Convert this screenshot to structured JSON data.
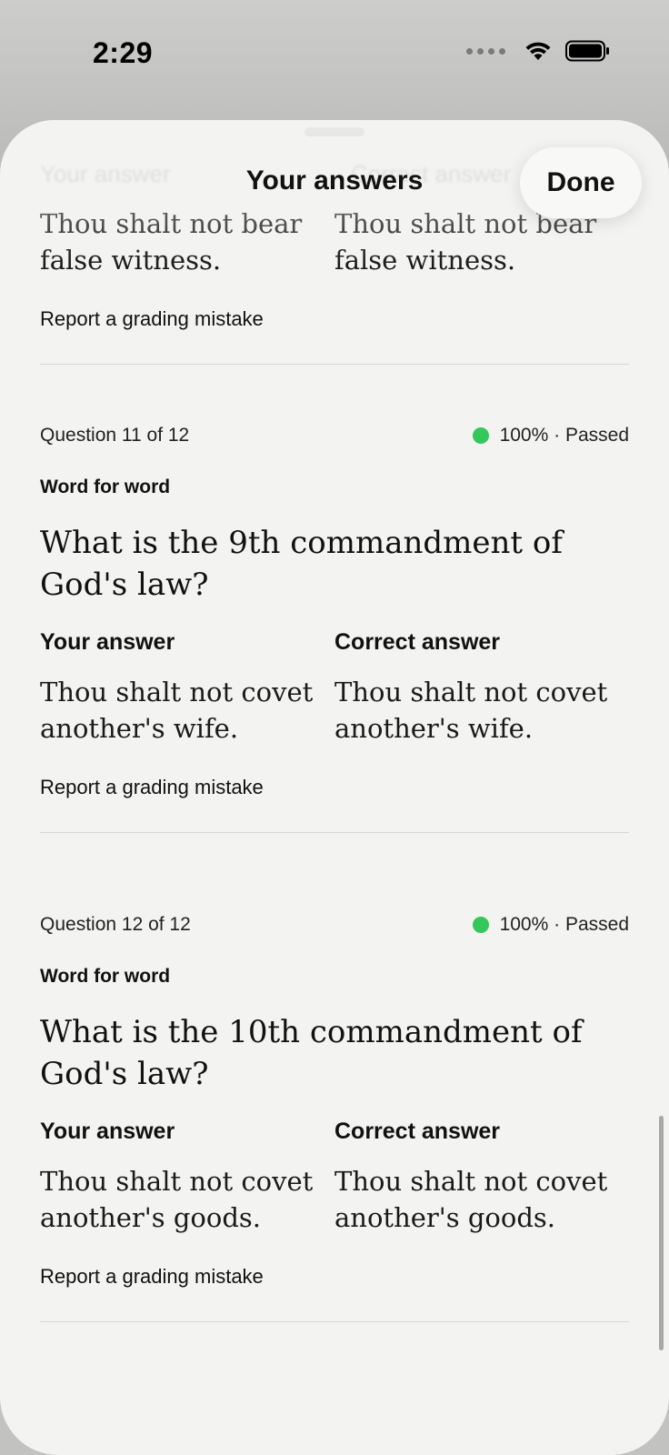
{
  "status_bar": {
    "time": "2:29"
  },
  "sheet": {
    "title": "Your answers",
    "done_label": "Done"
  },
  "ghost_header": {
    "your_label": "Your answer",
    "correct_label": "Correct answer"
  },
  "prev_card": {
    "your_answer": "Thou shalt not bear false witness.",
    "correct_answer": "Thou shalt not bear false witness.",
    "report_label": "Report a grading mistake"
  },
  "cards": [
    {
      "number": "Question 11 of 12",
      "score": "100% · Passed",
      "type": "Word for word",
      "question": "What is the 9th commandment of God's law?",
      "your_label": "Your answer",
      "correct_label": "Correct answer",
      "your_answer": "Thou shalt not covet another's wife.",
      "correct_answer": "Thou shalt not covet another's wife.",
      "report_label": "Report a grading mistake"
    },
    {
      "number": "Question 12 of 12",
      "score": "100% · Passed",
      "type": "Word for word",
      "question": "What is the 10th commandment of God's law?",
      "your_label": "Your answer",
      "correct_label": "Correct answer",
      "your_answer": "Thou shalt not covet another's goods.",
      "correct_answer": "Thou shalt not covet another's goods.",
      "report_label": "Report a grading mistake"
    }
  ],
  "colors": {
    "passed": "#34c759",
    "sheet_bg": "#f3f3f1"
  }
}
